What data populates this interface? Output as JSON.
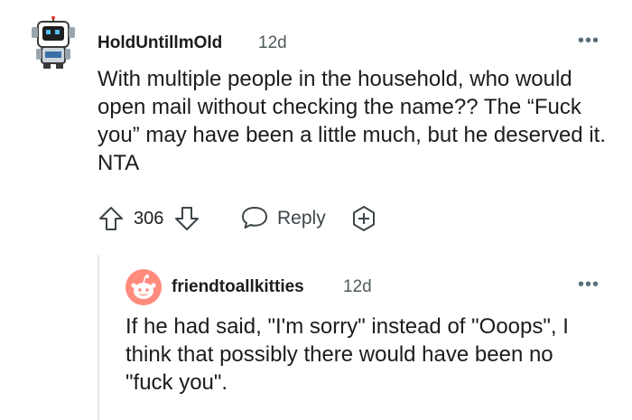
{
  "comment": {
    "username": "HoldUntillmOld",
    "age": "12d",
    "more": "•••",
    "body": "With multiple people in the household, who would open mail without checking the name?? The “Fuck you” may have been a little much, but he deserved it. NTA",
    "score": "306",
    "reply_label": "Reply",
    "icons": {
      "upvote": "upvote-arrow-icon",
      "downvote": "downvote-arrow-icon",
      "reply": "speech-bubble-icon",
      "award": "award-plus-icon"
    }
  },
  "reply": {
    "username": "friendtoallkitties",
    "age": "12d",
    "more": "•••",
    "body": "If he had said, \"I'm sorry\" instead of \"Ooops\", I think that possibly there would have been no \"fuck you\"."
  },
  "colors": {
    "avatar_reply": "#ff8b7d",
    "thread_line": "#e6e8ea",
    "meta": "#4f5a5e"
  }
}
